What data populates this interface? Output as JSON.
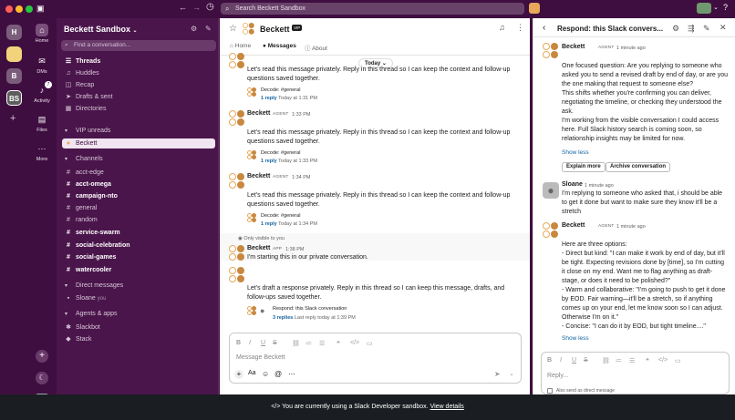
{
  "app": {
    "search_placeholder": "Search Beckett Sandbox"
  },
  "rail": {
    "workspaces": [
      "H",
      "",
      "B",
      "BS"
    ],
    "items": [
      {
        "label": "Home"
      },
      {
        "label": "DMs"
      },
      {
        "label": "Activity",
        "badge": "7"
      },
      {
        "label": "Files"
      },
      {
        "label": "More"
      }
    ]
  },
  "sidebar": {
    "workspace_name": "Beckett Sandbox",
    "find_placeholder": "Find a conversation...",
    "nav": [
      {
        "label": "Threads",
        "icon": "threads-icon",
        "bold": true
      },
      {
        "label": "Huddles",
        "icon": "headphones-icon"
      },
      {
        "label": "Recap",
        "icon": "recap-icon"
      },
      {
        "label": "Drafts & sent",
        "icon": "send-icon"
      },
      {
        "label": "Directories",
        "icon": "directory-icon"
      }
    ],
    "vip_label": "VIP unreads",
    "vip_items": [
      {
        "label": "Beckett"
      }
    ],
    "channels_label": "Channels",
    "channels": [
      {
        "label": "acct-edge",
        "bold": false
      },
      {
        "label": "acct-omega",
        "bold": true
      },
      {
        "label": "campaign-nto",
        "bold": true
      },
      {
        "label": "general",
        "bold": false
      },
      {
        "label": "random",
        "bold": false
      },
      {
        "label": "service-swarm",
        "bold": true
      },
      {
        "label": "social-celebration",
        "bold": true
      },
      {
        "label": "social-games",
        "bold": true
      },
      {
        "label": "watercooler",
        "bold": true
      }
    ],
    "dm_label": "Direct messages",
    "dm_items": [
      {
        "label": "Sloane",
        "suffix": "you"
      }
    ],
    "apps_label": "Agents & apps",
    "apps": [
      {
        "label": "Slackbot"
      },
      {
        "label": "Stack"
      }
    ]
  },
  "main": {
    "title": "Beckett",
    "title_badge": "VIP",
    "tabs": [
      "Home",
      "Messages",
      "About"
    ],
    "date_divider": "Today",
    "messages": [
      {
        "author": "",
        "tag": "",
        "time": "",
        "text": "Let's read this message privately. Reply in this thread so I can keep the context and follow-up questions saved together.",
        "decode": "Decode: #general",
        "reply_count": "1 reply",
        "reply_time": "Today at 1:31 PM"
      },
      {
        "author": "Beckett",
        "tag": "AGENT",
        "time": "1:33 PM",
        "text": "Let's read this message privately. Reply in this thread so I can keep the context and follow-up questions saved together.",
        "decode": "Decode: #general",
        "reply_count": "1 reply",
        "reply_time": "Today at 1:33 PM"
      },
      {
        "author": "Beckett",
        "tag": "AGENT",
        "time": "1:34 PM",
        "text": "Let's read this message privately. Reply in this thread so I can keep the context and follow-up questions saved together.",
        "decode": "Decode: #general",
        "reply_count": "1 reply",
        "reply_time": "Today at 1:34 PM"
      }
    ],
    "private_note": "Only visible to you",
    "private_msg": {
      "author": "Beckett",
      "tag": "APP",
      "time": "1:38 PM",
      "text": "I'm starting this in our private conversation."
    },
    "draft_msg": {
      "text": "Let's draft a response privately. Reply in this thread so I can keep this message, drafts, and follow-ups saved together.",
      "thread_title": "Respond: this Slack conversation",
      "reply_count": "3 replies",
      "reply_time": "Last reply today at 1:39 PM"
    },
    "composer_placeholder": "Message Beckett"
  },
  "panel": {
    "title": "Respond: this Slack convers...",
    "messages": [
      {
        "author": "Beckett",
        "tag": "AGENT",
        "time": "1 minute ago",
        "lines": [
          "One focused question: Are you replying to someone who",
          "asked you to send a revised draft by end of day, or are you",
          "the one making that request to someone else?",
          "This shifts whether you're confirming you can deliver,",
          "negotiating the timeline, or checking they understood the",
          "ask.",
          "I'm working from the visible conversation I could access",
          "here. Full Slack history search is coming soon, so",
          "relationship insights may be limited for now."
        ],
        "show_less": "Show less",
        "buttons": [
          "Explain more",
          "Archive conversation"
        ]
      },
      {
        "author": "Sloane",
        "tag": "",
        "time": "1 minute ago",
        "lines": [
          "I'm replying to someone who asked that, i should be able",
          "to get it done but want to make sure they know it'll be a",
          "stretch"
        ]
      },
      {
        "author": "Beckett",
        "tag": "AGENT",
        "time": "1 minute ago",
        "lines": [
          "Here are three options:",
          "- Direct but kind: \"I can make it work by end of day, but it'll",
          "be tight. Expecting revisions done by [time], so I'm cutting",
          "it close on my end. Want me to flag anything as draft-",
          "stage, or does it need to be polished?\"",
          "- Warm and collaborative: \"I'm going to push to get it done",
          "by EOD. Fair warning—it'll be a stretch, so if anything",
          "comes up on your end, let me know soon so I can adjust.",
          "Otherwise I'm on it.\"",
          "- Concise: \"I can do it by EOD, but tight timeline....\""
        ],
        "show_less": "Show less"
      }
    ],
    "reply_placeholder": "Reply...",
    "also_send": "Also send as direct message"
  },
  "banner": {
    "text": "You are currently using a Slack Developer sandbox.",
    "link": "View details"
  }
}
